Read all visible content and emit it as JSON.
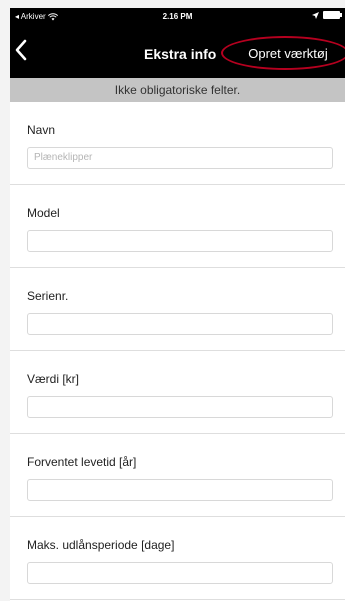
{
  "status_bar": {
    "carrier": "◂ Arkiver",
    "time": "2.16 PM",
    "location_icon": "location-arrow-icon",
    "wifi_icon": "wifi-icon",
    "battery_icon": "battery-icon"
  },
  "nav": {
    "back_icon": "chevron-left-icon",
    "title": "Ekstra info",
    "action_label": "Opret værktøj",
    "highlight_color": "#b5001f"
  },
  "subheader": "Ikke obligatoriske felter.",
  "fields": [
    {
      "label": "Navn",
      "placeholder": "Plæneklipper",
      "value": ""
    },
    {
      "label": "Model",
      "placeholder": "",
      "value": ""
    },
    {
      "label": "Serienr.",
      "placeholder": "",
      "value": ""
    },
    {
      "label": "Værdi [kr]",
      "placeholder": "",
      "value": ""
    },
    {
      "label": "Forventet levetid  [år]",
      "placeholder": "",
      "value": ""
    },
    {
      "label": "Maks. udlånsperiode [dage]",
      "placeholder": "",
      "value": ""
    }
  ]
}
